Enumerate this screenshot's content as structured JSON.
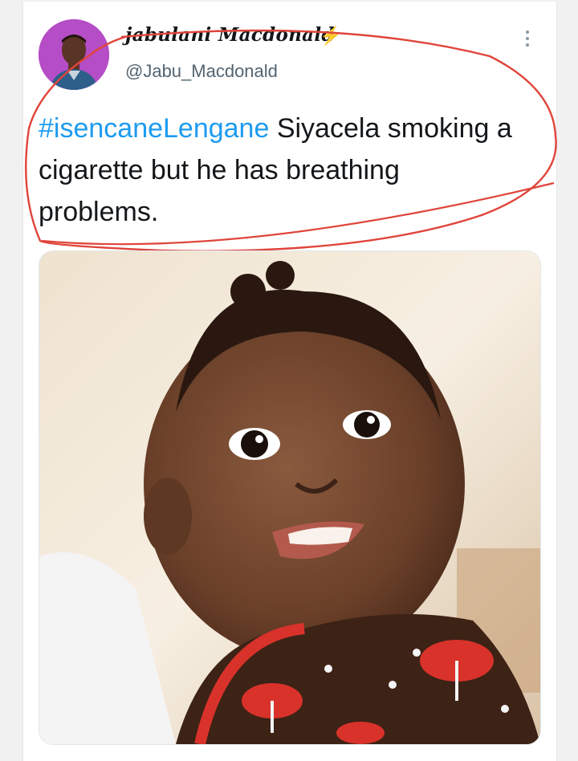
{
  "tweet": {
    "display_name": "jabulani Macdonald",
    "handle": "@Jabu_Macdonald",
    "verified_icon": "lightning-emoji-icon",
    "more_icon": "more-options-icon",
    "hashtag": "#isencaneLengane",
    "text_rest": " Siyacela smoking a cigarette but he has breathing problems.",
    "media_description_icon": "photo"
  },
  "colors": {
    "link": "#1d9bf0",
    "annotation": "#e0443a",
    "text": "#14171a",
    "handle": "#536471"
  }
}
